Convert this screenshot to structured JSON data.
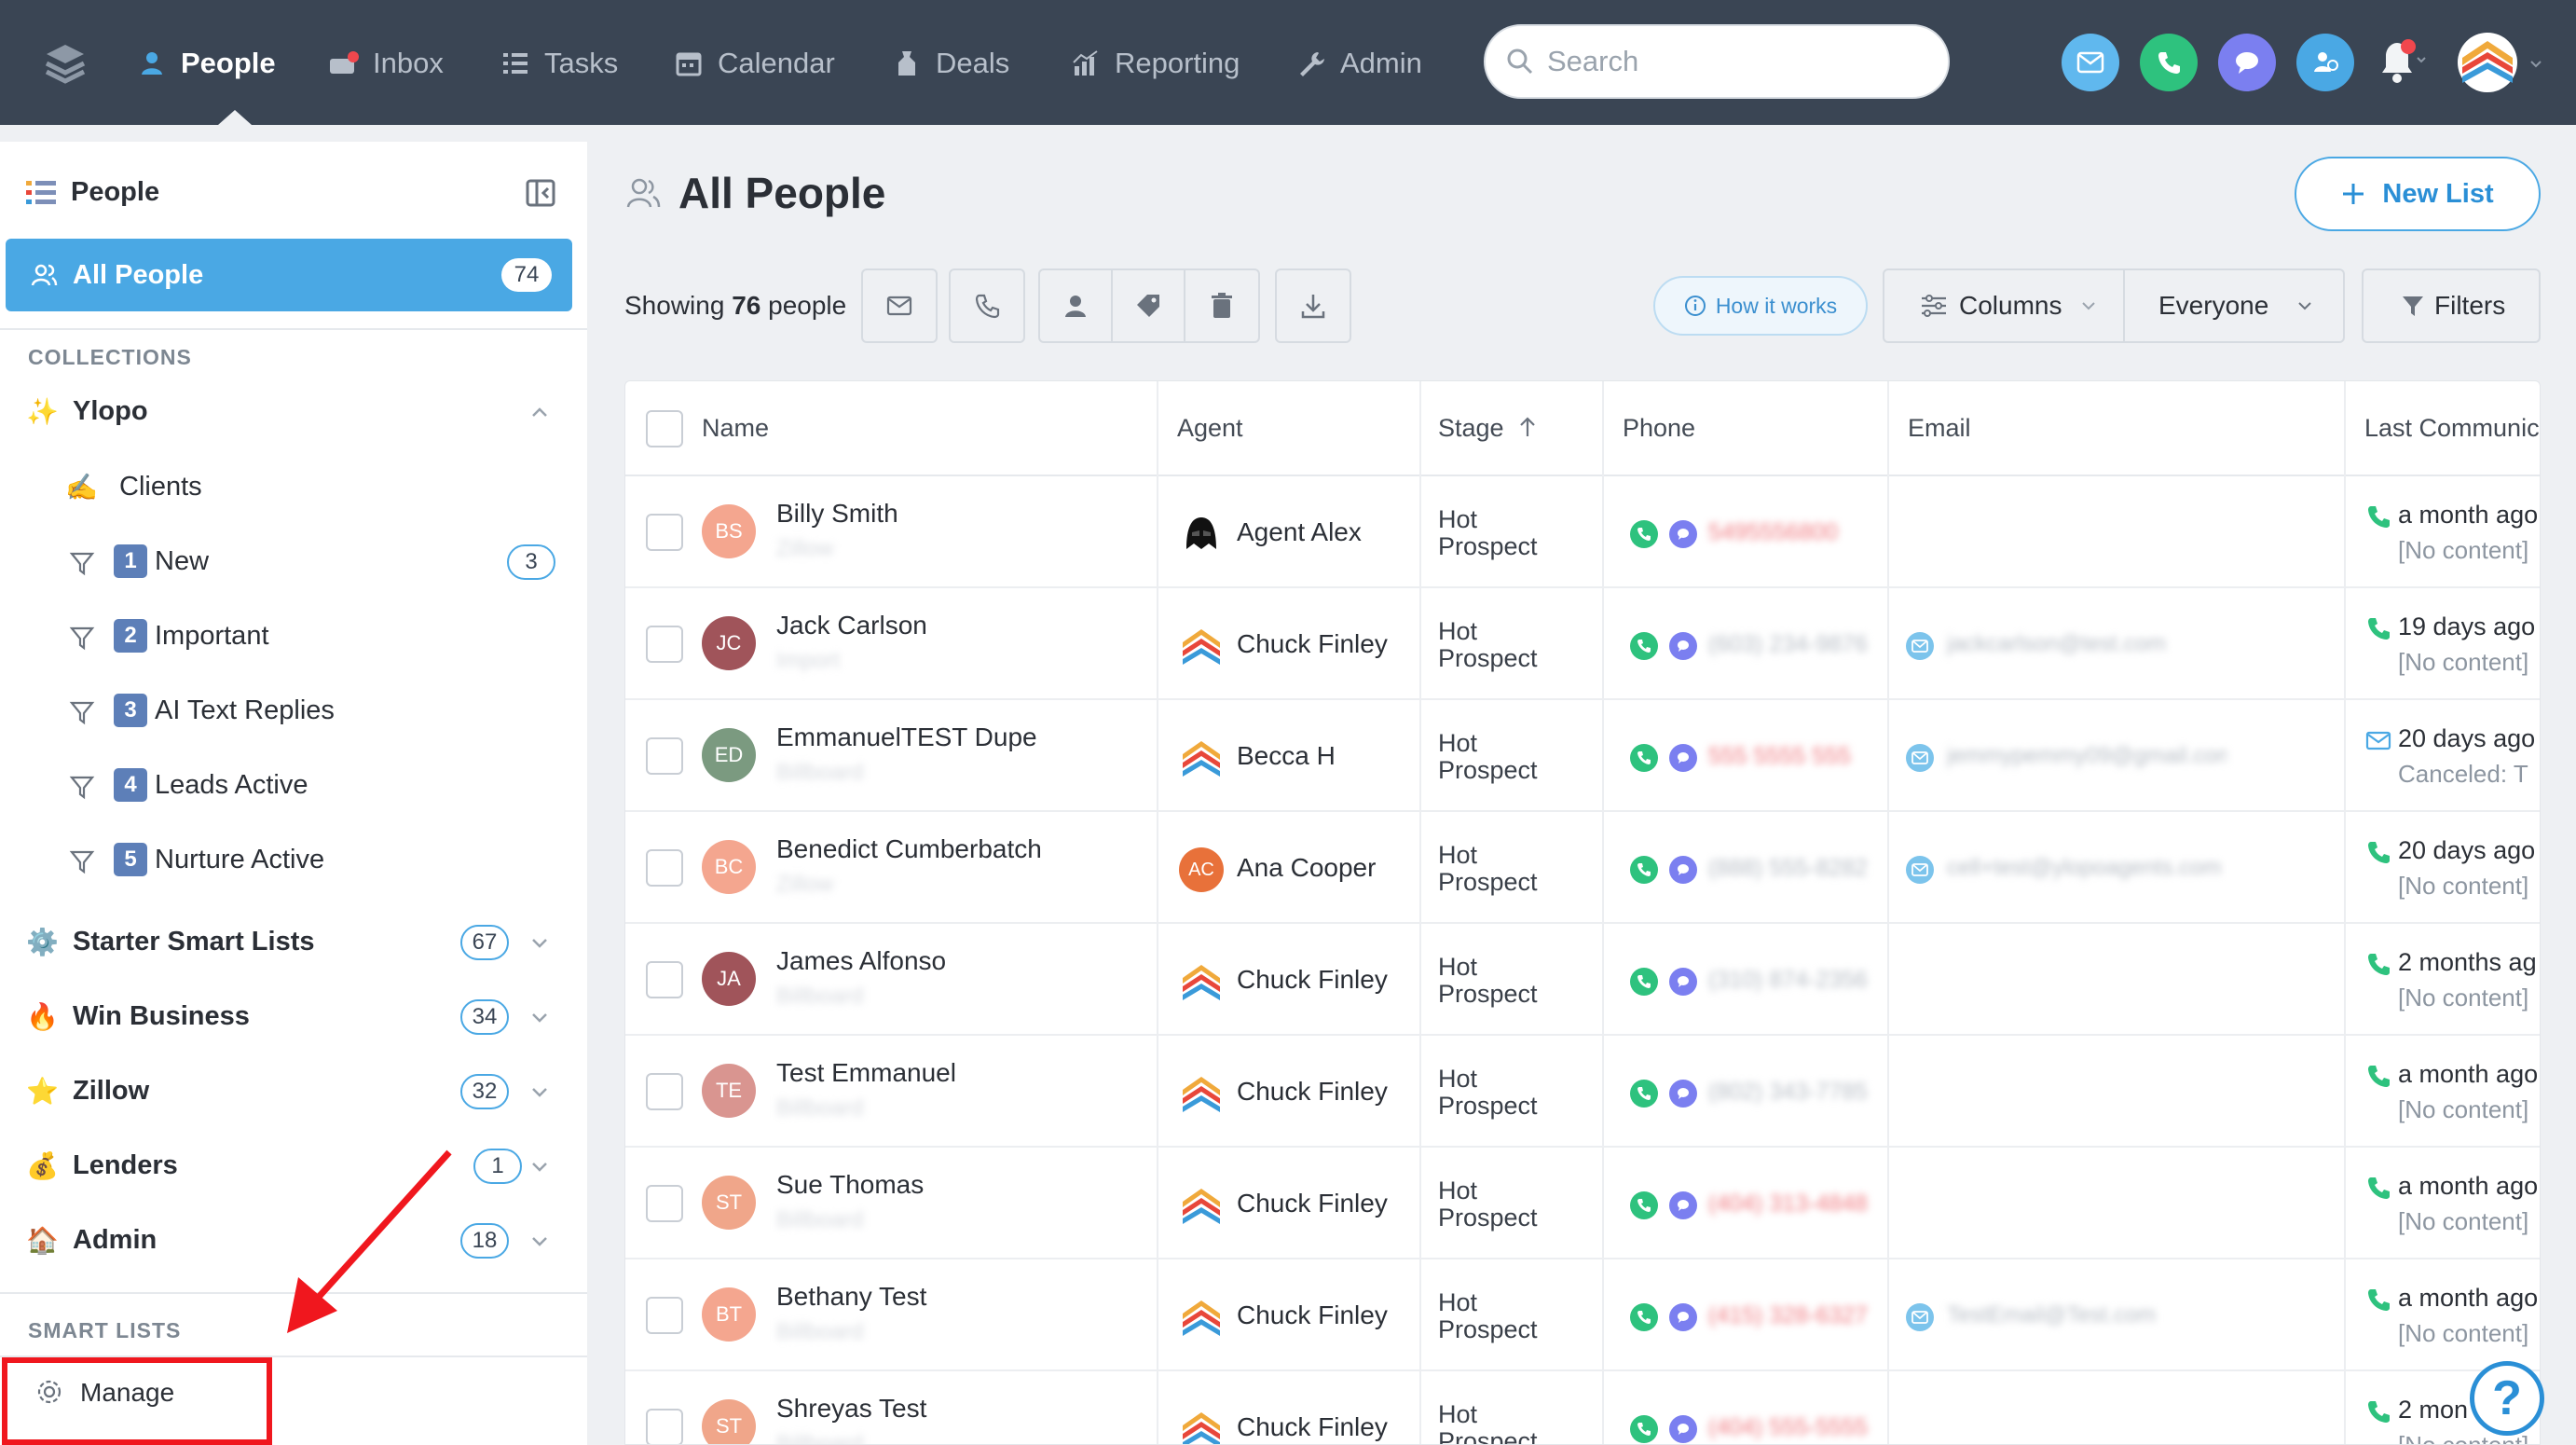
{
  "nav": {
    "items": [
      {
        "label": "People",
        "icon": "people-icon",
        "active": true
      },
      {
        "label": "Inbox",
        "icon": "inbox-icon"
      },
      {
        "label": "Tasks",
        "icon": "tasks-icon"
      },
      {
        "label": "Calendar",
        "icon": "calendar-icon"
      },
      {
        "label": "Deals",
        "icon": "deals-icon"
      },
      {
        "label": "Reporting",
        "icon": "reporting-icon"
      },
      {
        "label": "Admin",
        "icon": "admin-icon"
      }
    ],
    "search_placeholder": "Search",
    "right_icons": [
      "email-icon",
      "phone-icon",
      "chat-icon",
      "contacts-icon",
      "bell-icon",
      "account-avatar"
    ]
  },
  "sidebar": {
    "header": "People",
    "all_people": {
      "label": "All People",
      "count": "74"
    },
    "collections_title": "COLLECTIONS",
    "ylopo": {
      "label": "Ylopo",
      "icon": "sparkles-icon"
    },
    "ylopo_children": [
      {
        "label": "Clients",
        "icon": "writing-hand-icon"
      },
      {
        "num": "1",
        "label": "New",
        "count": "3"
      },
      {
        "num": "2",
        "label": "Important"
      },
      {
        "num": "3",
        "label": "AI Text Replies"
      },
      {
        "num": "4",
        "label": "Leads Active"
      },
      {
        "num": "5",
        "label": "Nurture Active"
      }
    ],
    "collections": [
      {
        "label": "Starter Smart Lists",
        "count": "67",
        "icon": "gear-emoji-icon"
      },
      {
        "label": "Win Business",
        "count": "34",
        "icon": "fire-icon"
      },
      {
        "label": "Zillow",
        "count": "32",
        "icon": "star-icon"
      },
      {
        "label": "Lenders",
        "count": "1",
        "icon": "money-bag-icon"
      },
      {
        "label": "Admin",
        "count": "18",
        "icon": "house-icon"
      }
    ],
    "smart_lists_title": "SMART LISTS",
    "manage_label": "Manage"
  },
  "main": {
    "title": "All People",
    "new_list_label": "New List",
    "showing_prefix": "Showing",
    "showing_count": "76",
    "showing_suffix": "people",
    "toolbar_icons": [
      "email-icon",
      "phone-icon",
      "assign-icon",
      "tag-icon",
      "trash-icon",
      "download-icon"
    ],
    "how_it_works": "How it works",
    "columns_label": "Columns",
    "everyone_label": "Everyone",
    "filters_label": "Filters"
  },
  "table": {
    "headers": {
      "name": "Name",
      "agent": "Agent",
      "stage": "Stage",
      "phone": "Phone",
      "email": "Email",
      "last": "Last Communic"
    },
    "rows": [
      {
        "initials": "BS",
        "name": "Billy Smith",
        "source": "Zillow",
        "agent": "Agent Alex",
        "stage": "Hot Prospect",
        "phone": "5495556800",
        "email": "",
        "lc_icon": "phone",
        "lc_time": "a month ago",
        "lc_note": "[No content]"
      },
      {
        "initials": "JC",
        "name": "Jack Carlson",
        "source": "Import",
        "agent": "Chuck Finley",
        "stage": "Hot Prospect",
        "phone": "(603) 234-9876",
        "email": "jackcarlson@test.com",
        "lc_icon": "phone",
        "lc_time": "19 days ago",
        "lc_note": "[No content]"
      },
      {
        "initials": "ED",
        "name": "EmmanuelTEST Dupe",
        "source": "Billboard",
        "agent": "Becca H",
        "stage": "Hot Prospect",
        "phone": "555 5555 555",
        "email": "jemmypemmy09@gmail.com",
        "lc_icon": "email",
        "lc_time": "20 days ago",
        "lc_note": "Canceled: T"
      },
      {
        "initials": "BC",
        "name": "Benedict Cumberbatch",
        "source": "Zillow",
        "agent": "Ana Cooper",
        "stage": "Hot Prospect",
        "phone": "(888) 555-8282",
        "email": "cell+test@ylopoagents.com",
        "lc_icon": "phone",
        "lc_time": "20 days ago",
        "lc_note": "[No content]"
      },
      {
        "initials": "JA",
        "name": "James Alfonso",
        "source": "Billboard",
        "agent": "Chuck Finley",
        "stage": "Hot Prospect",
        "phone": "(310) 874-2356",
        "email": "",
        "lc_icon": "phone",
        "lc_time": "2 months ag",
        "lc_note": "[No content]"
      },
      {
        "initials": "TE",
        "name": "Test Emmanuel",
        "source": "Billboard",
        "agent": "Chuck Finley",
        "stage": "Hot Prospect",
        "phone": "(802) 343-7785",
        "email": "",
        "lc_icon": "phone",
        "lc_time": "a month ago",
        "lc_note": "[No content]"
      },
      {
        "initials": "ST",
        "name": "Sue Thomas",
        "source": "Billboard",
        "agent": "Chuck Finley",
        "stage": "Hot Prospect",
        "phone": "(404) 313-4848",
        "email": "",
        "lc_icon": "phone",
        "lc_time": "a month ago",
        "lc_note": "[No content]"
      },
      {
        "initials": "BT",
        "name": "Bethany Test",
        "source": "Billboard",
        "agent": "Chuck Finley",
        "stage": "Hot Prospect",
        "phone": "(415) 328-6327",
        "email": "TestEmail@Test.com",
        "lc_icon": "phone",
        "lc_time": "a month ago",
        "lc_note": "[No content]"
      },
      {
        "initials": "ST",
        "name": "Shreyas Test",
        "source": "Billboard",
        "agent": "Chuck Finley",
        "stage": "Hot Prospect",
        "phone": "(404) 555-5555",
        "email": "",
        "lc_icon": "phone",
        "lc_time": "2 mon",
        "lc_note": "[No content]"
      }
    ]
  },
  "colors": {
    "nav_bg": "#3a4554",
    "accent": "#4aa8e4",
    "annotation_red": "#f0171e",
    "phone_green": "#2ec27e",
    "chat_purple": "#7b7ff0"
  },
  "help_label": "?"
}
